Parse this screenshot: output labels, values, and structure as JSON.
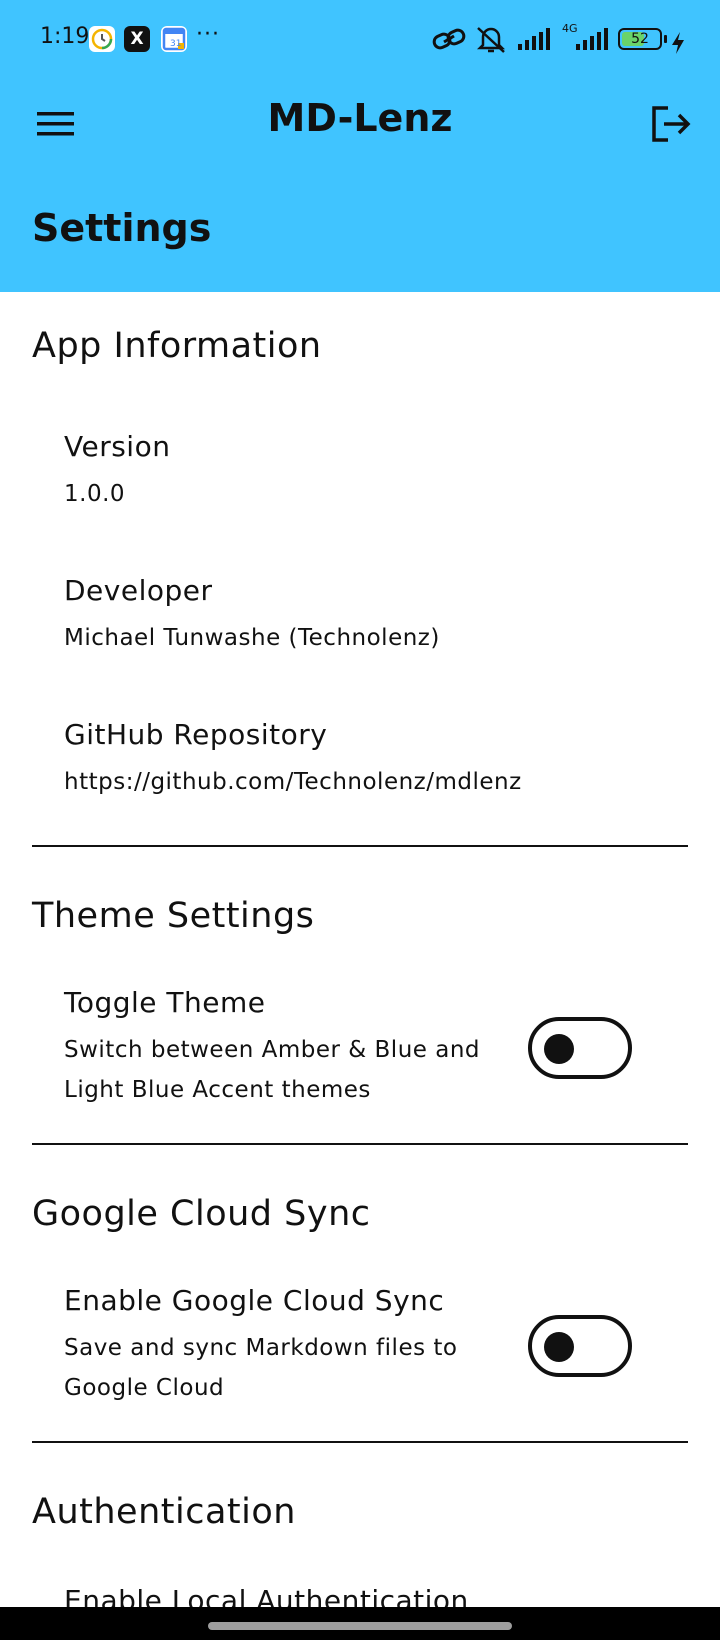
{
  "status": {
    "time": "1:19",
    "more": "···",
    "network_label": "4G",
    "battery": "52"
  },
  "appbar": {
    "title": "MD-Lenz"
  },
  "page": {
    "title": "Settings"
  },
  "sections": {
    "app_info": {
      "title": "App Information",
      "version_title": "Version",
      "version_value": "1.0.0",
      "developer_title": "Developer",
      "developer_value": "Michael Tunwashe (Technolenz)",
      "repo_title": "GitHub Repository",
      "repo_value": "https://github.com/Technolenz/mdlenz"
    },
    "theme": {
      "title": "Theme Settings",
      "toggle_title": "Toggle Theme",
      "toggle_sub": "Switch between Amber & Blue and Light Blue Accent themes",
      "toggle_on": false
    },
    "cloud": {
      "title": "Google Cloud Sync",
      "toggle_title": "Enable Google Cloud Sync",
      "toggle_sub": "Save and sync Markdown files to Google Cloud",
      "toggle_on": false
    },
    "auth": {
      "title": "Authentication",
      "item_title": "Enable Local Authentication"
    }
  },
  "colors": {
    "header": "#40c4ff",
    "text": "#111111",
    "background": "#ffffff"
  }
}
